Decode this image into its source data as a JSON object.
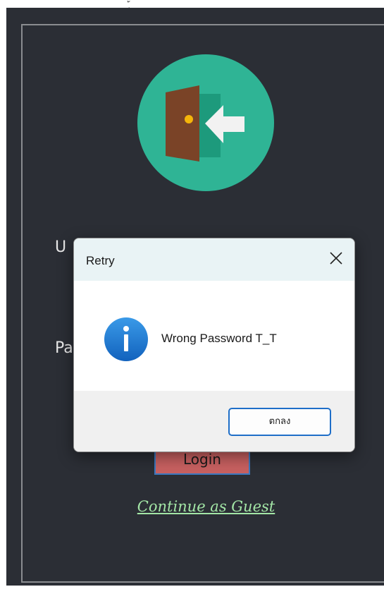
{
  "top_strip": {
    "glyph": "ุ้"
  },
  "login_form": {
    "username_label": "U",
    "password_label": "Pa",
    "login_label": "Login",
    "guest_link": "Continue as Guest"
  },
  "dialog": {
    "title": "Retry",
    "message": "Wrong Password T_T",
    "ok_label": "ตกลง",
    "icon": "info-icon",
    "close_icon": "close-icon"
  },
  "colors": {
    "app_background": "#2b2e35",
    "logo_circle": "#2fb495",
    "login_button": "#c76060",
    "guest_link": "#a3e6a6",
    "info_icon": "#1e78d2",
    "dialog_accent": "#1e6ec8"
  }
}
